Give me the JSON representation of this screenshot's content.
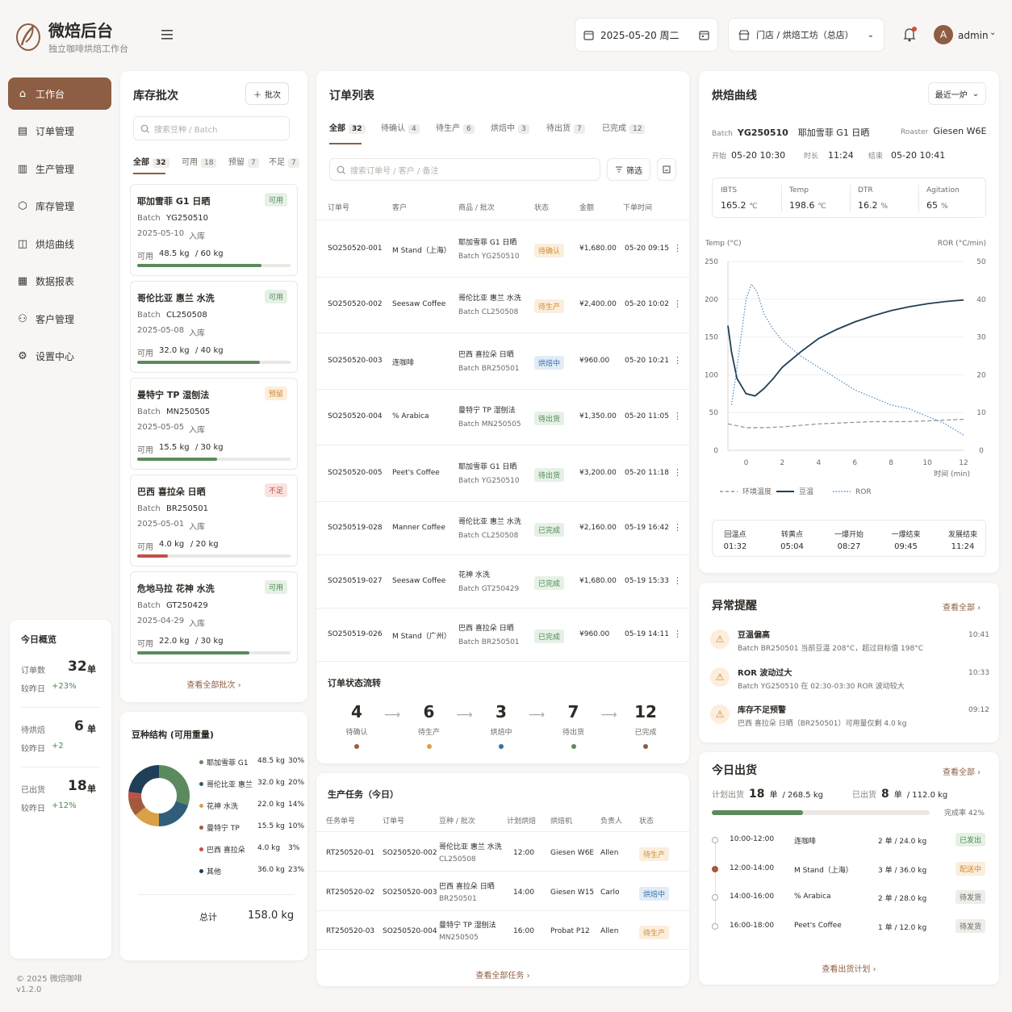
{
  "brand": {
    "name": "微焙后台",
    "subtitle": "独立咖啡烘焙工作台"
  },
  "header": {
    "date": "2025-05-20 周二",
    "store": "门店 / 烘焙工坊（总店）",
    "user": "admin",
    "avatar_letter": "A"
  },
  "nav": [
    {
      "label": "工作台",
      "icon": "home-icon"
    },
    {
      "label": "订单管理",
      "icon": "document-icon"
    },
    {
      "label": "生产管理",
      "icon": "factory-icon"
    },
    {
      "label": "库存管理",
      "icon": "box-icon"
    },
    {
      "label": "烘焙曲线",
      "icon": "chart-icon"
    },
    {
      "label": "数据报表",
      "icon": "report-icon"
    },
    {
      "label": "客户管理",
      "icon": "users-icon"
    },
    {
      "label": "设置中心",
      "icon": "gear-icon"
    }
  ],
  "overview": {
    "title": "今日概览",
    "items": [
      {
        "label": "订单数",
        "value": "32",
        "unit": "单",
        "cmp_label": "较昨日",
        "cmp": "+23%"
      },
      {
        "label": "待烘焙",
        "value": "6",
        "unit": "单",
        "cmp_label": "较昨日",
        "cmp": "+2"
      },
      {
        "label": "已出货",
        "value": "18",
        "unit": "单",
        "cmp_label": "较昨日",
        "cmp": "+12%"
      }
    ]
  },
  "footer": {
    "copyright": "© 2025 微焙咖啡",
    "version": "v1.2.0"
  },
  "inventory": {
    "title": "库存批次",
    "add_label": "批次",
    "search_placeholder": "搜索豆种 / Batch",
    "tabs": [
      {
        "label": "全部",
        "count": "32"
      },
      {
        "label": "可用",
        "count": "18"
      },
      {
        "label": "预留",
        "count": "7"
      },
      {
        "label": "不足",
        "count": "7"
      }
    ],
    "batches": [
      {
        "name": "耶加雪菲 G1 日晒",
        "status": "可用",
        "tone": "green",
        "batch_label": "Batch",
        "batch": "YG250510",
        "date": "2025-05-10",
        "in_label": "入库",
        "avail_label": "可用",
        "avail": "48.5 kg",
        "total": "/ 60 kg",
        "ratio": 0.81,
        "bar": "#5b8a5e"
      },
      {
        "name": "哥伦比亚 惠兰 水洗",
        "status": "可用",
        "tone": "green",
        "batch_label": "Batch",
        "batch": "CL250508",
        "date": "2025-05-08",
        "in_label": "入库",
        "avail_label": "可用",
        "avail": "32.0 kg",
        "total": "/ 40 kg",
        "ratio": 0.8,
        "bar": "#5b8a5e"
      },
      {
        "name": "曼特宁 TP 湿刨法",
        "status": "预留",
        "tone": "orange",
        "batch_label": "Batch",
        "batch": "MN250505",
        "date": "2025-05-05",
        "in_label": "入库",
        "avail_label": "可用",
        "avail": "15.5 kg",
        "total": "/ 30 kg",
        "ratio": 0.52,
        "bar": "#5b8a5e"
      },
      {
        "name": "巴西 喜拉朵 日晒",
        "status": "不足",
        "tone": "red",
        "batch_label": "Batch",
        "batch": "BR250501",
        "date": "2025-05-01",
        "in_label": "入库",
        "avail_label": "可用",
        "avail": "4.0 kg",
        "total": "/ 20 kg",
        "ratio": 0.2,
        "bar": "#c14f45"
      },
      {
        "name": "危地马拉 花神 水洗",
        "status": "可用",
        "tone": "green",
        "batch_label": "Batch",
        "batch": "GT250429",
        "date": "2025-04-29",
        "in_label": "入库",
        "avail_label": "可用",
        "avail": "22.0 kg",
        "total": "/ 30 kg",
        "ratio": 0.73,
        "bar": "#5b8a5e"
      }
    ],
    "view_all": "查看全部批次"
  },
  "bean_structure": {
    "title": "豆种结构 (可用重量)",
    "total_label": "总计",
    "total": "158.0 kg",
    "items": [
      {
        "name": "耶加雪菲 G1",
        "weight": "48.5 kg",
        "pct": "30%",
        "value": 30,
        "color": "#5b8a5e"
      },
      {
        "name": "哥伦比亚 惠兰",
        "weight": "32.0 kg",
        "pct": "20%",
        "value": 20,
        "color": "#2f5d7a"
      },
      {
        "name": "花神 水洗",
        "weight": "22.0 kg",
        "pct": "14%",
        "value": 14,
        "color": "#d9a04a"
      },
      {
        "name": "曼特宁 TP",
        "weight": "15.5 kg",
        "pct": "10%",
        "value": 10,
        "color": "#a25a3d"
      },
      {
        "name": "巴西 喜拉朵",
        "weight": "4.0 kg",
        "pct": "3%",
        "value": 3,
        "color": "#c14f45"
      },
      {
        "name": "其他",
        "weight": "36.0 kg",
        "pct": "23%",
        "value": 23,
        "color": "#1e3f55"
      }
    ]
  },
  "orders": {
    "title": "订单列表",
    "search_placeholder": "搜索订单号 / 客户 / 备注",
    "filter_label": "筛选",
    "tabs": [
      {
        "label": "全部",
        "count": "32"
      },
      {
        "label": "待确认",
        "count": "4"
      },
      {
        "label": "待生产",
        "count": "6"
      },
      {
        "label": "烘焙中",
        "count": "3"
      },
      {
        "label": "待出货",
        "count": "7"
      },
      {
        "label": "已完成",
        "count": "12"
      }
    ],
    "columns": [
      "订单号",
      "客户",
      "商品 / 批次",
      "状态",
      "金额",
      "下单时间"
    ],
    "rows": [
      {
        "id": "SO250520-001",
        "customer": "M Stand（上海）",
        "product": "耶加雪菲 G1 日晒",
        "batch": "Batch  YG250510",
        "status": "待确认",
        "tone": "orange",
        "amount": "¥1,680.00",
        "time": "05-20 09:15"
      },
      {
        "id": "SO250520-002",
        "customer": "Seesaw Coffee",
        "product": "哥伦比亚 惠兰 水洗",
        "batch": "Batch  CL250508",
        "status": "待生产",
        "tone": "orange",
        "amount": "¥2,400.00",
        "time": "05-20 10:02"
      },
      {
        "id": "SO250520-003",
        "customer": "连咖啡",
        "product": "巴西 喜拉朵 日晒",
        "batch": "Batch  BR250501",
        "status": "烘焙中",
        "tone": "blue",
        "amount": "¥960.00",
        "time": "05-20 10:21"
      },
      {
        "id": "SO250520-004",
        "customer": "% Arabica",
        "product": "曼特宁 TP 湿刨法",
        "batch": "Batch  MN250505",
        "status": "待出货",
        "tone": "green",
        "amount": "¥1,350.00",
        "time": "05-20 11:05"
      },
      {
        "id": "SO250520-005",
        "customer": "Peet's Coffee",
        "product": "耶加雪菲 G1 日晒",
        "batch": "Batch  YG250510",
        "status": "待出货",
        "tone": "green",
        "amount": "¥3,200.00",
        "time": "05-20 11:18"
      },
      {
        "id": "SO250519-028",
        "customer": "Manner Coffee",
        "product": "哥伦比亚 惠兰 水洗",
        "batch": "Batch  CL250508",
        "status": "已完成",
        "tone": "green",
        "amount": "¥2,160.00",
        "time": "05-19 16:42"
      },
      {
        "id": "SO250519-027",
        "customer": "Seesaw Coffee",
        "product": "花神 水洗",
        "batch": "Batch  GT250429",
        "status": "已完成",
        "tone": "green",
        "amount": "¥1,680.00",
        "time": "05-19 15:33"
      },
      {
        "id": "SO250519-026",
        "customer": "M Stand（广州）",
        "product": "巴西 喜拉朵 日晒",
        "batch": "Batch  BR250501",
        "status": "已完成",
        "tone": "green",
        "amount": "¥960.00",
        "time": "05-19 14:11"
      }
    ],
    "flow_title": "订单状态流转",
    "flow": [
      {
        "count": "4",
        "label": "待确认",
        "color": "#a25a3d"
      },
      {
        "count": "6",
        "label": "待生产",
        "color": "#d9a04a"
      },
      {
        "count": "3",
        "label": "烘焙中",
        "color": "#3b6ea5"
      },
      {
        "count": "7",
        "label": "待出货",
        "color": "#5b8a5e"
      },
      {
        "count": "12",
        "label": "已完成",
        "color": "#8d5e43"
      }
    ]
  },
  "tasks": {
    "title": "生产任务（今日）",
    "columns": [
      "任务单号",
      "订单号",
      "豆种 / 批次",
      "计划烘焙",
      "烘焙机",
      "负责人",
      "状态"
    ],
    "rows": [
      {
        "id": "RT250520-01",
        "order": "SO250520-002",
        "bean": "哥伦比亚 惠兰 水洗",
        "batch": "CL250508",
        "time": "12:00",
        "machine": "Giesen W6E",
        "owner": "Allen",
        "status": "待生产",
        "tone": "orange"
      },
      {
        "id": "RT250520-02",
        "order": "SO250520-003",
        "bean": "巴西 喜拉朵 日晒",
        "batch": "BR250501",
        "time": "14:00",
        "machine": "Giesen W15",
        "owner": "Carlo",
        "status": "烘焙中",
        "tone": "blue"
      },
      {
        "id": "RT250520-03",
        "order": "SO250520-004",
        "bean": "曼特宁 TP 湿刨法",
        "batch": "MN250505",
        "time": "16:00",
        "machine": "Probat P12",
        "owner": "Allen",
        "status": "待生产",
        "tone": "orange"
      }
    ],
    "view_all": "查看全部任务"
  },
  "roast": {
    "title": "烘焙曲线",
    "range": "最近一炉",
    "batch_label": "Batch",
    "batch": "YG250510",
    "bean": "耶加雪菲 G1 日晒",
    "roaster_label": "Roaster",
    "roaster": "Giesen W6E",
    "start_label": "开始",
    "start": "05-20 10:30",
    "dur_label": "时长",
    "dur": "11:24",
    "end_label": "结束",
    "end": "05-20 10:41",
    "metrics": [
      {
        "label": "IBTS",
        "value": "165.2",
        "unit": "℃"
      },
      {
        "label": "Temp",
        "value": "198.6",
        "unit": "℃"
      },
      {
        "label": "DTR",
        "value": "16.2",
        "unit": "%"
      },
      {
        "label": "Agitation",
        "value": "65",
        "unit": "%"
      }
    ],
    "events": [
      {
        "label": "回温点",
        "time": "01:32"
      },
      {
        "label": "转黄点",
        "time": "05:04"
      },
      {
        "label": "一爆开始",
        "time": "08:27"
      },
      {
        "label": "一爆结束",
        "time": "09:45"
      },
      {
        "label": "发展结束",
        "time": "11:24"
      }
    ]
  },
  "chart_data": {
    "type": "line",
    "xlabel": "时间 (min)",
    "ylabel": "Temp (°C)",
    "y2label": "ROR (°C/min)",
    "xlim": [
      -1,
      12
    ],
    "ylim": [
      0,
      250
    ],
    "y2lim": [
      0,
      50
    ],
    "xticks": [
      0,
      2,
      4,
      6,
      8,
      10,
      12
    ],
    "yticks": [
      0,
      50,
      100,
      150,
      200,
      250
    ],
    "y2ticks": [
      0,
      10,
      20,
      30,
      40,
      50
    ],
    "legend": [
      "环境温度",
      "豆温",
      "ROR"
    ],
    "series": [
      {
        "name": "环境温度",
        "axis": "left",
        "color": "#9a9590",
        "style": "dashed",
        "x": [
          -1,
          0,
          1,
          2,
          3,
          4,
          5,
          6,
          7,
          8,
          9,
          10,
          11,
          12
        ],
        "y": [
          35,
          30,
          30,
          31,
          33,
          35,
          36,
          37,
          38,
          38,
          38,
          39,
          40,
          41
        ]
      },
      {
        "name": "豆温",
        "axis": "left",
        "color": "#1e3f55",
        "style": "solid",
        "x": [
          -1,
          -0.8,
          -0.5,
          0,
          0.5,
          1,
          1.5,
          2,
          3,
          4,
          5,
          6,
          7,
          8,
          9,
          10,
          11,
          12
        ],
        "y": [
          165,
          130,
          95,
          75,
          72,
          82,
          95,
          110,
          130,
          148,
          160,
          170,
          178,
          185,
          190,
          194,
          197,
          199
        ]
      },
      {
        "name": "ROR",
        "axis": "right",
        "color": "#5b8fc7",
        "style": "dotted",
        "x": [
          -0.8,
          -0.5,
          0,
          0.3,
          0.6,
          1,
          1.5,
          2,
          3,
          4,
          5,
          6,
          7,
          8,
          9,
          10,
          11,
          12
        ],
        "y": [
          12,
          22,
          40,
          44,
          42,
          36,
          32,
          29,
          25,
          22,
          19,
          16,
          14,
          12,
          11,
          9,
          7,
          4
        ]
      }
    ]
  },
  "alerts": {
    "title": "异常提醒",
    "view_all": "查看全部",
    "items": [
      {
        "title": "豆温偏高",
        "desc": "Batch BR250501 当前豆温 208°C，超过目标值 198°C",
        "time": "10:41"
      },
      {
        "title": "ROR 波动过大",
        "desc": "Batch YG250510 在 02:30-03:30 ROR 波动较大",
        "time": "10:33"
      },
      {
        "title": "库存不足预警",
        "desc": "巴西 喜拉朵 日晒（BR250501）可用量仅剩 4.0 kg",
        "time": "09:12"
      }
    ]
  },
  "shipping": {
    "title": "今日出货",
    "view_all": "查看全部",
    "plan_label": "计划出货",
    "plan_count": "18",
    "plan_unit": "单",
    "plan_weight": "/ 268.5 kg",
    "done_label": "已出货",
    "done_count": "8",
    "done_unit": "单",
    "done_weight": "/ 112.0 kg",
    "rate_label": "完成率",
    "rate": "42%",
    "ratio": 0.42,
    "items": [
      {
        "time": "10:00-12:00",
        "customer": "连咖啡",
        "qty": "2 单 / 24.0 kg",
        "status": "已发出",
        "tone": "green"
      },
      {
        "time": "12:00-14:00",
        "customer": "M Stand（上海）",
        "qty": "3 单 / 36.0 kg",
        "status": "配送中",
        "tone": "orange"
      },
      {
        "time": "14:00-16:00",
        "customer": "% Arabica",
        "qty": "2 单 / 28.0 kg",
        "status": "待发货",
        "tone": "gray"
      },
      {
        "time": "16:00-18:00",
        "customer": "Peet's Coffee",
        "qty": "1 单 / 12.0 kg",
        "status": "待发货",
        "tone": "gray"
      }
    ],
    "footer": "查看出货计划"
  }
}
